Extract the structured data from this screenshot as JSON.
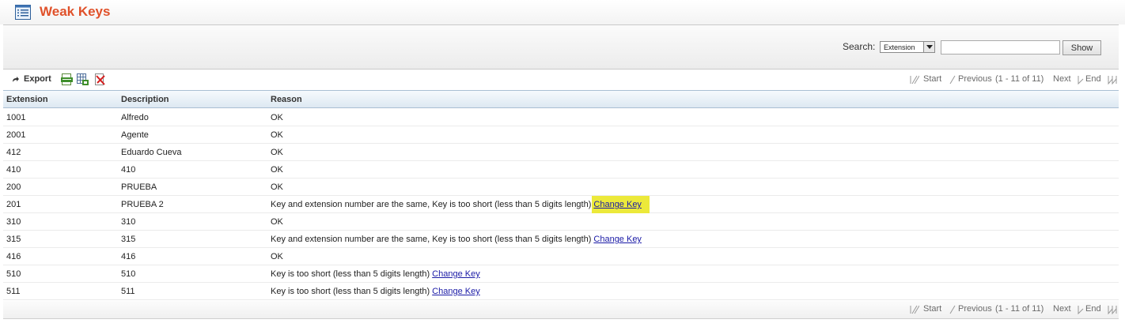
{
  "header": {
    "title": "Weak Keys",
    "icon": "list-table-icon"
  },
  "filter": {
    "search_label": "Search:",
    "search_field_selected": "Extension",
    "search_value": "",
    "show_label": "Show"
  },
  "toolbar": {
    "export_label": "Export",
    "icons": [
      "export-csv-icon",
      "export-spreadsheet-icon",
      "export-pdf-icon"
    ]
  },
  "pager": {
    "start_label": "Start",
    "previous_label": "Previous",
    "info": "(1 - 11 of 11)",
    "next_label": "Next",
    "end_label": "End"
  },
  "table": {
    "columns": [
      "Extension",
      "Description",
      "Reason"
    ],
    "rows": [
      {
        "extension": "1001",
        "description": "Alfredo",
        "reason": "OK",
        "link": ""
      },
      {
        "extension": "2001",
        "description": "Agente",
        "reason": "OK",
        "link": ""
      },
      {
        "extension": "412",
        "description": "Eduardo Cueva",
        "reason": "OK",
        "link": ""
      },
      {
        "extension": "410",
        "description": "410",
        "reason": "OK",
        "link": ""
      },
      {
        "extension": "200",
        "description": "PRUEBA",
        "reason": "OK",
        "link": ""
      },
      {
        "extension": "201",
        "description": "PRUEBA 2",
        "reason": "Key and extension number are the same, Key is too short (less than 5 digits length)",
        "link": "Change Key",
        "highlighted": true
      },
      {
        "extension": "310",
        "description": "310",
        "reason": "OK",
        "link": ""
      },
      {
        "extension": "315",
        "description": "315",
        "reason": "Key and extension number are the same, Key is too short (less than 5 digits length)",
        "link": "Change Key"
      },
      {
        "extension": "416",
        "description": "416",
        "reason": "OK",
        "link": ""
      },
      {
        "extension": "510",
        "description": "510",
        "reason": "Key is too short (less than 5 digits length)",
        "link": "Change Key"
      },
      {
        "extension": "511",
        "description": "511",
        "reason": "Key is too short (less than 5 digits length)",
        "link": "Change Key"
      }
    ]
  },
  "colors": {
    "title": "#e0512a",
    "link": "#1a1aa6",
    "highlight": "#ece93a",
    "header_bg": "#dde8f2"
  }
}
